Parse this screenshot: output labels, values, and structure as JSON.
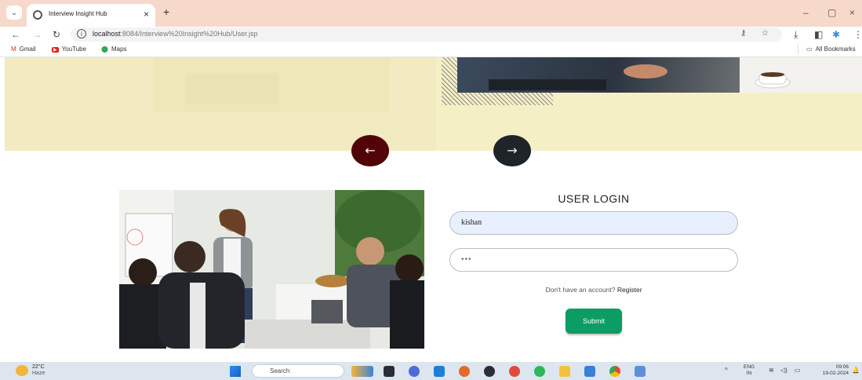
{
  "browser": {
    "tab_title": "Interview Insight Hub",
    "new_tab": "+",
    "url_host": "localhost",
    "url_rest": ":8084/Interview%20Insight%20Hub/User.jsp",
    "bookmarks": [
      {
        "label": "Gmail",
        "icon": "gmail-icon"
      },
      {
        "label": "YouTube",
        "icon": "youtube-icon"
      },
      {
        "label": "Maps",
        "icon": "maps-icon"
      }
    ],
    "all_bookmarks": "All Bookmarks"
  },
  "hero": {
    "prev_arrow": "←",
    "next_arrow": "→"
  },
  "login": {
    "title": "USER LOGIN",
    "username_value": "kishan",
    "password_value": "•••",
    "register_prompt": "Don't have an account? ",
    "register_link": "Register",
    "submit_label": "Submit"
  },
  "taskbar": {
    "temperature": "22°C",
    "weather": "Haze",
    "search_placeholder": "Search",
    "lang_top": "ENG",
    "lang_bottom": "IN",
    "time": "09:06",
    "date": "19-02-2024"
  },
  "colors": {
    "hero_bg": "#f5efc5",
    "prev_btn": "#520307",
    "next_btn": "#1f2429",
    "submit_bg": "#0b9d63",
    "username_bg": "#e8f0fe"
  }
}
